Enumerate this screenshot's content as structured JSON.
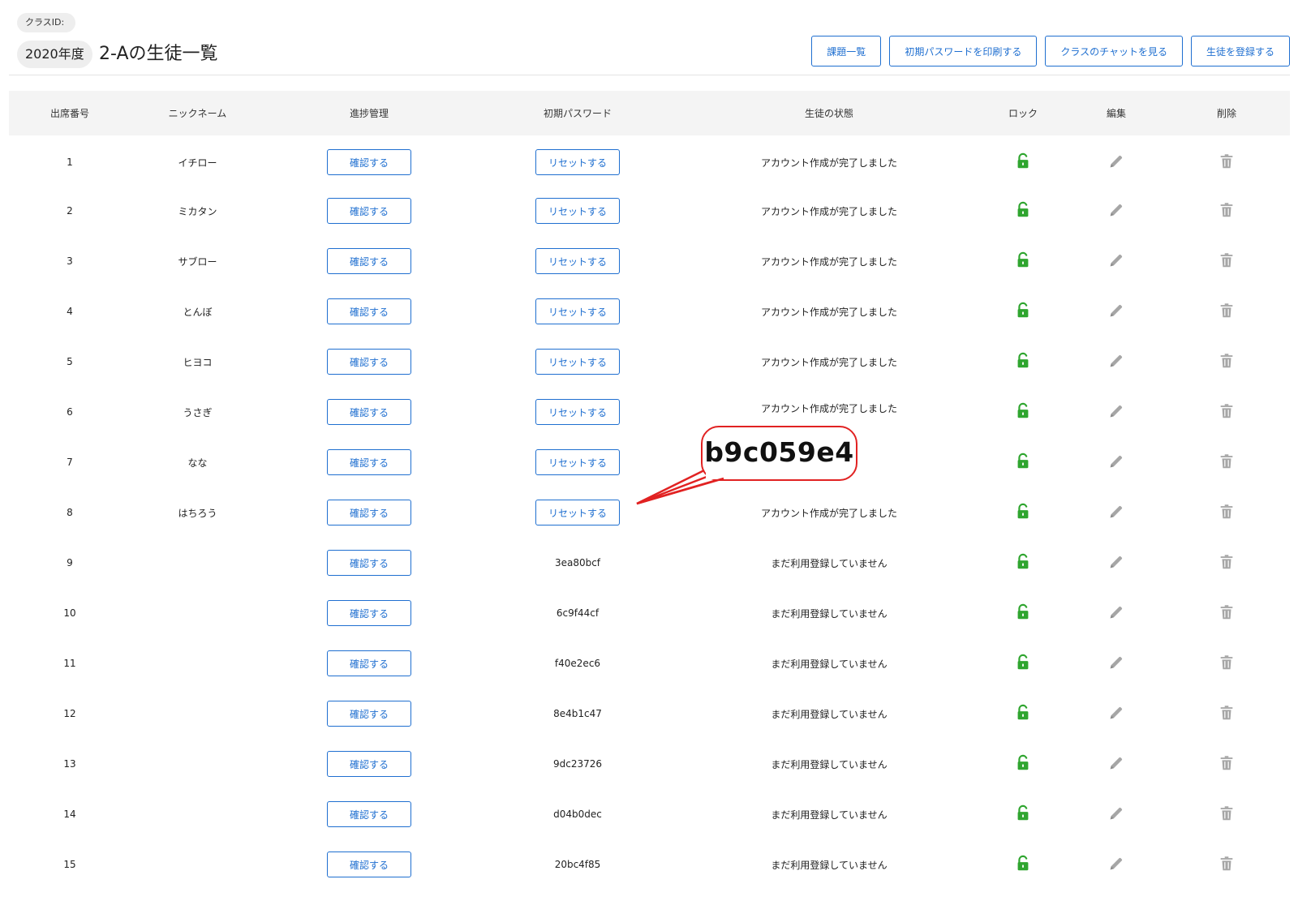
{
  "class_id_label": "クラスID:",
  "year_label": "2020年度",
  "class_title": "2-Aの生徒一覧",
  "header_actions": [
    {
      "name": "assignments-button",
      "label": "課題一覧"
    },
    {
      "name": "print-passwords-button",
      "label": "初期パスワードを印刷する"
    },
    {
      "name": "class-chat-button",
      "label": "クラスのチャットを見る"
    },
    {
      "name": "register-students-button",
      "label": "生徒を登録する"
    }
  ],
  "table": {
    "headers": {
      "number": "出席番号",
      "nickname": "ニックネーム",
      "progress": "進捗管理",
      "password": "初期パスワード",
      "status": "生徒の状態",
      "lock": "ロック",
      "edit": "編集",
      "delete": "削除"
    },
    "confirm_label": "確認する",
    "reset_label": "リセットする",
    "rows": [
      {
        "number": "1",
        "nickname": "イチロー",
        "password": null,
        "status": "アカウント作成が完了しました"
      },
      {
        "number": "2",
        "nickname": "ミカタン",
        "password": null,
        "status": "アカウント作成が完了しました"
      },
      {
        "number": "3",
        "nickname": "サブロー",
        "password": null,
        "status": "アカウント作成が完了しました"
      },
      {
        "number": "4",
        "nickname": "とんぼ",
        "password": null,
        "status": "アカウント作成が完了しました"
      },
      {
        "number": "5",
        "nickname": "ヒヨコ",
        "password": null,
        "status": "アカウント作成が完了しました"
      },
      {
        "number": "6",
        "nickname": "うさぎ",
        "password": null,
        "status": "アカウント作成が完了しました"
      },
      {
        "number": "7",
        "nickname": "なな",
        "password": null,
        "status": ""
      },
      {
        "number": "8",
        "nickname": "はちろう",
        "password": null,
        "status": "アカウント作成が完了しました"
      },
      {
        "number": "9",
        "nickname": "",
        "password": "3ea80bcf",
        "status": "まだ利用登録していません"
      },
      {
        "number": "10",
        "nickname": "",
        "password": "6c9f44cf",
        "status": "まだ利用登録していません"
      },
      {
        "number": "11",
        "nickname": "",
        "password": "f40e2ec6",
        "status": "まだ利用登録していません"
      },
      {
        "number": "12",
        "nickname": "",
        "password": "8e4b1c47",
        "status": "まだ利用登録していません"
      },
      {
        "number": "13",
        "nickname": "",
        "password": "9dc23726",
        "status": "まだ利用登録していません"
      },
      {
        "number": "14",
        "nickname": "",
        "password": "d04b0dec",
        "status": "まだ利用登録していません"
      },
      {
        "number": "15",
        "nickname": "",
        "password": "20bc4f85",
        "status": "まだ利用登録していません"
      }
    ]
  },
  "callout": {
    "text": "b9c059e4"
  },
  "colors": {
    "accent": "#1f6fd0",
    "lock_green": "#2fa52f",
    "icon_gray": "#a6a6a6",
    "callout_red": "#e12222",
    "header_row_bg": "#f4f4f4"
  },
  "icons": {
    "lock": "unlocked-padlock-icon",
    "edit": "pencil-icon",
    "delete": "trash-icon"
  }
}
